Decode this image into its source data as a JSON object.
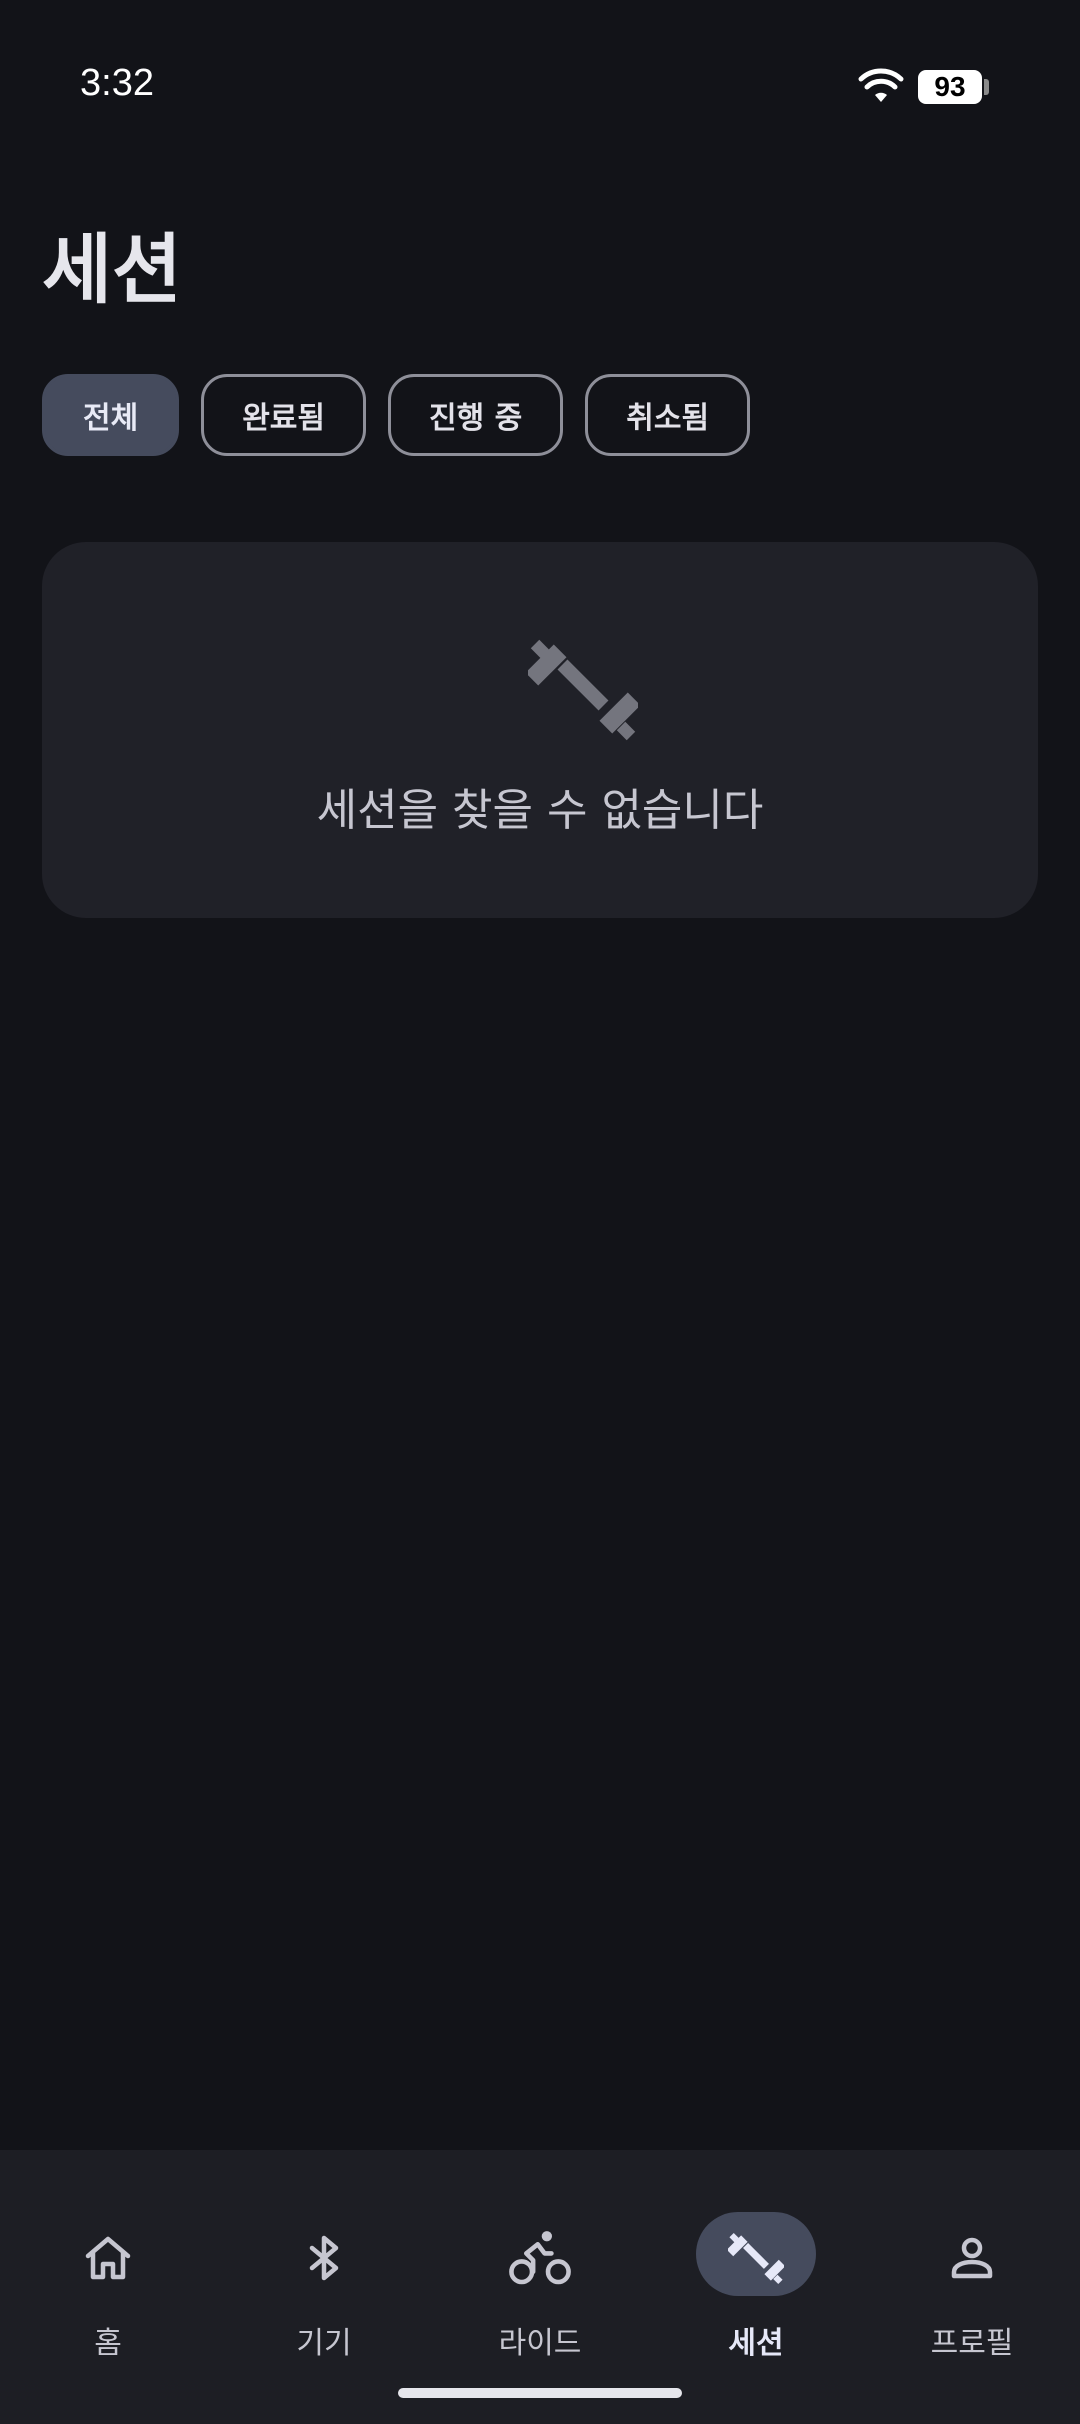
{
  "status_bar": {
    "time": "3:32",
    "battery": "93",
    "icons": [
      "wifi-icon",
      "battery-icon"
    ]
  },
  "page": {
    "title": "세션"
  },
  "filters": {
    "chips": [
      {
        "label": "전체",
        "selected": true
      },
      {
        "label": "완료됨",
        "selected": false
      },
      {
        "label": "진행 중",
        "selected": false
      },
      {
        "label": "취소됨",
        "selected": false
      }
    ]
  },
  "empty_state": {
    "icon": "dumbbell-icon",
    "message": "세션을 찾을 수 없습니다"
  },
  "bottom_nav": {
    "items": [
      {
        "label": "홈",
        "icon": "home-icon",
        "active": false
      },
      {
        "label": "기기",
        "icon": "bluetooth-icon",
        "active": false
      },
      {
        "label": "라이드",
        "icon": "bike-icon",
        "active": false
      },
      {
        "label": "세션",
        "icon": "dumbbell-icon",
        "active": true
      },
      {
        "label": "프로필",
        "icon": "person-icon",
        "active": false
      }
    ]
  },
  "colors": {
    "background": "#121318",
    "card": "#202128",
    "chip_selected": "#454b5d",
    "nav_background": "#1d1e24"
  }
}
